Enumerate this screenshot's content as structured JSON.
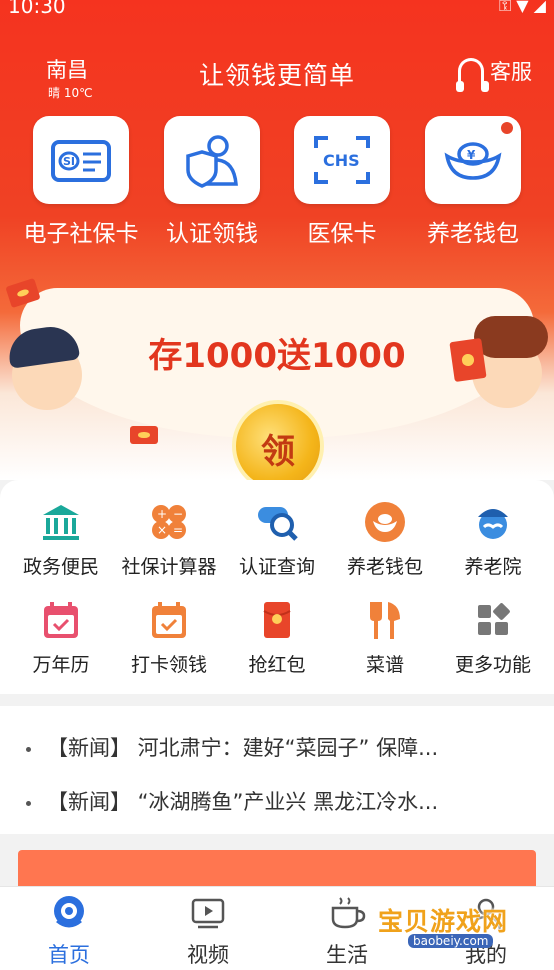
{
  "status": {
    "time": "10:30"
  },
  "header": {
    "city": "南昌",
    "weather": "晴 10℃",
    "title": "让领钱更简单",
    "service_label": "客服"
  },
  "quick_actions": [
    {
      "label": "电子社保卡",
      "icon": "social-security-card-icon"
    },
    {
      "label": "认证领钱",
      "icon": "identity-verify-icon"
    },
    {
      "label": "医保卡",
      "icon": "chs-medical-card-icon"
    },
    {
      "label": "养老钱包",
      "icon": "gold-ingot-icon"
    }
  ],
  "banner": {
    "headline": "存1000送1000",
    "coin_label": "领"
  },
  "services": [
    {
      "label": "政务便民",
      "icon": "government-building-icon",
      "color": "#1aa89a"
    },
    {
      "label": "社保计算器",
      "icon": "calculator-icon",
      "color": "#f0813a"
    },
    {
      "label": "认证查询",
      "icon": "search-query-icon",
      "color": "#3b8de0"
    },
    {
      "label": "养老钱包",
      "icon": "wallet-ingot-icon",
      "color": "#f0813a"
    },
    {
      "label": "养老院",
      "icon": "nursing-home-icon",
      "color": "#3b8de0"
    },
    {
      "label": "万年历",
      "icon": "calendar-icon",
      "color": "#e8506e"
    },
    {
      "label": "打卡领钱",
      "icon": "checkin-calendar-icon",
      "color": "#f0813a"
    },
    {
      "label": "抢红包",
      "icon": "red-envelope-icon",
      "color": "#e8452a"
    },
    {
      "label": "菜谱",
      "icon": "cutlery-icon",
      "color": "#f0813a"
    },
    {
      "label": "更多功能",
      "icon": "more-grid-icon",
      "color": "#777777"
    }
  ],
  "news": [
    {
      "text": "【新闻】 河北肃宁：建好“菜园子” 保障..."
    },
    {
      "text": "【新闻】 “冰湖腾鱼”产业兴 黑龙江冷水..."
    }
  ],
  "bottom_nav": [
    {
      "label": "首页",
      "icon": "home-icon",
      "active": true
    },
    {
      "label": "视频",
      "icon": "video-icon",
      "active": false
    },
    {
      "label": "生活",
      "icon": "cup-icon",
      "active": false
    },
    {
      "label": "我的",
      "icon": "profile-icon",
      "active": false
    }
  ],
  "watermark": {
    "text": "宝贝游戏网",
    "sub": "baobeiy.com"
  }
}
